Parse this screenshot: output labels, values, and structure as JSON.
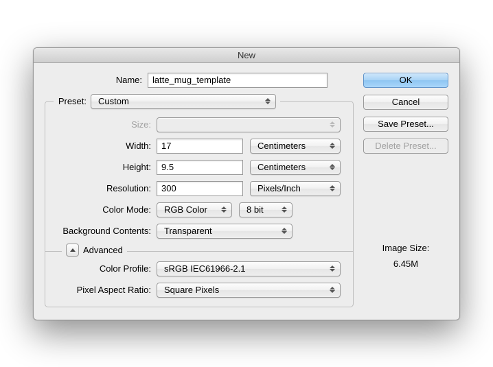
{
  "title": "New",
  "name": {
    "label": "Name:",
    "value": "latte_mug_template"
  },
  "preset": {
    "label": "Preset:",
    "value": "Custom"
  },
  "size": {
    "label": "Size:",
    "value": ""
  },
  "width": {
    "label": "Width:",
    "value": "17",
    "unit": "Centimeters"
  },
  "height": {
    "label": "Height:",
    "value": "9.5",
    "unit": "Centimeters"
  },
  "resolution": {
    "label": "Resolution:",
    "value": "300",
    "unit": "Pixels/Inch"
  },
  "colorMode": {
    "label": "Color Mode:",
    "value": "RGB Color",
    "depth": "8 bit"
  },
  "bgContents": {
    "label": "Background Contents:",
    "value": "Transparent"
  },
  "advanced": {
    "label": "Advanced"
  },
  "colorProfile": {
    "label": "Color Profile:",
    "value": "sRGB IEC61966-2.1"
  },
  "pixelAspect": {
    "label": "Pixel Aspect Ratio:",
    "value": "Square Pixels"
  },
  "buttons": {
    "ok": "OK",
    "cancel": "Cancel",
    "savePreset": "Save Preset...",
    "deletePreset": "Delete Preset..."
  },
  "imageSize": {
    "label": "Image Size:",
    "value": "6.45M"
  }
}
